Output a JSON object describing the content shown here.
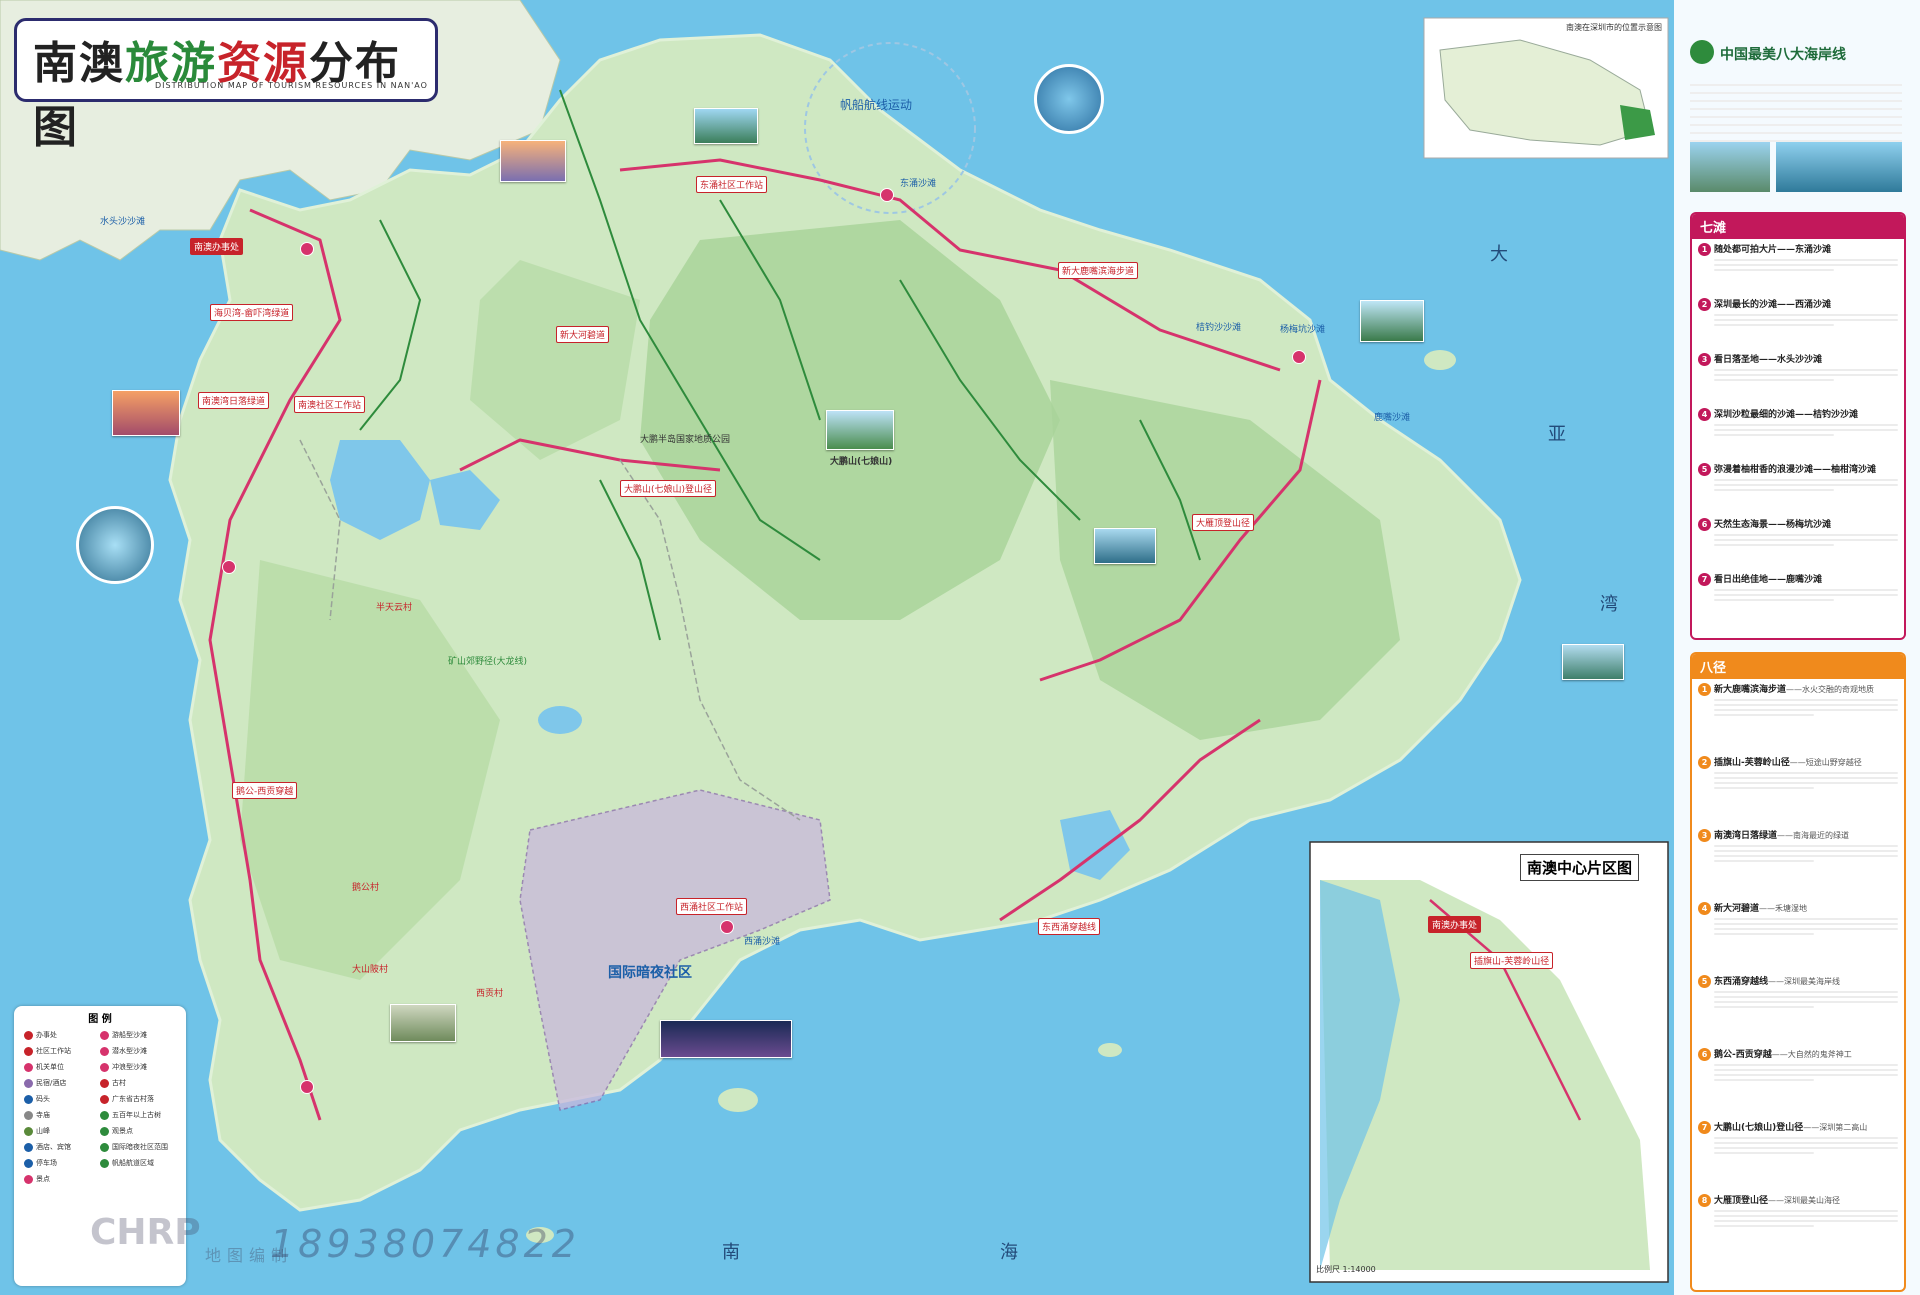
{
  "title": {
    "part1": "南澳",
    "part2": "旅游",
    "part3": "资源",
    "part4": "分布图",
    "subtitle": "DISTRIBUTION MAP OF TOURISM RESOURCES IN NAN'AO"
  },
  "colors": {
    "sea": "#6fc3e8",
    "land": "#cfe8c2",
    "forest": "#a9d39a",
    "route": "#d6336c",
    "trail": "#2e8b3c",
    "accent_pink": "#c2185b",
    "accent_orange": "#f08a1c"
  },
  "sea_labels": {
    "da": "大",
    "ya": "亚",
    "wan": "湾",
    "nan": "南",
    "hai": "海"
  },
  "locator": {
    "title": "南澳在深圳市的位置示意图"
  },
  "coast_panel": {
    "title": "中国最美八大海岸线"
  },
  "qitan": {
    "header": "七滩",
    "items": [
      {
        "num": "1",
        "title": "随处都可拍大片——东涌沙滩"
      },
      {
        "num": "2",
        "title": "深圳最长的沙滩——西涌沙滩"
      },
      {
        "num": "3",
        "title": "看日落圣地——水头沙沙滩"
      },
      {
        "num": "4",
        "title": "深圳沙粒最细的沙滩——桔钓沙沙滩"
      },
      {
        "num": "5",
        "title": "弥漫着柚柑香的浪漫沙滩——柚柑湾沙滩"
      },
      {
        "num": "6",
        "title": "天然生态海景——杨梅坑沙滩"
      },
      {
        "num": "7",
        "title": "看日出绝佳地——鹿嘴沙滩"
      }
    ]
  },
  "bajing": {
    "header": "八径",
    "items": [
      {
        "num": "1",
        "title": "新大鹿嘴滨海步道",
        "sub": "——水火交融的奇观地质"
      },
      {
        "num": "2",
        "title": "插旗山-芙蓉岭山径",
        "sub": "——短途山野穿越径"
      },
      {
        "num": "3",
        "title": "南澳湾日落绿道",
        "sub": "——南海最近的绿道"
      },
      {
        "num": "4",
        "title": "新大河碧道",
        "sub": "——禾塘湿地"
      },
      {
        "num": "5",
        "title": "东西涌穿越线",
        "sub": "——深圳最美海岸线"
      },
      {
        "num": "6",
        "title": "鹅公-西贡穿越",
        "sub": "——大自然的鬼斧神工"
      },
      {
        "num": "7",
        "title": "大鹏山(七娘山)登山径",
        "sub": "——深圳第二高山"
      },
      {
        "num": "8",
        "title": "大雁顶登山径",
        "sub": "——深圳最美山海径"
      }
    ]
  },
  "inset": {
    "title": "南澳中心片区图",
    "office": "南澳办事处",
    "trail": "插旗山-芙蓉岭山径",
    "scale": "比例尺 1:14000"
  },
  "legend": {
    "title": "图 例",
    "left": [
      "办事处",
      "社区工作站",
      "机关单位",
      "民宿/酒店",
      "码头",
      "寺庙",
      "山峰",
      "酒店、宾馆",
      "停车场",
      "景点"
    ],
    "right": [
      "游船型沙滩",
      "潜水型沙滩",
      "冲浪型沙滩",
      "古村",
      "广东省古村落",
      "五百年以上古树",
      "观景点",
      "国际暗夜社区范围",
      "帆船航道区域"
    ]
  },
  "map_labels": {
    "office": "南澳办事处",
    "haibei": "海贝湾-畲吓湾绿道",
    "nanao_sunset": "南澳湾日落绿道",
    "xinda_river": "新大河碧道",
    "dapeng_shan": "大鹏山(七娘山)登山径",
    "dayan_ding": "大雁顶登山径",
    "egong": "鹅公-西贡穿越",
    "east_west": "东西涌穿越线",
    "xinda_luzui": "新大鹿嘴滨海步道",
    "sailing": "帆船航线运动",
    "dark_sky": "国际暗夜社区",
    "kuangshan": "矿山郊野径(大龙线)",
    "dongchong_work": "东涌社区工作站",
    "xichong_work": "西涌社区工作站",
    "shuitousha": "水头沙沙滩",
    "xichong_beach": "西涌沙滩",
    "dongchong_beach": "东涌沙滩",
    "yanggang": "杨梅坑沙滩",
    "luzui": "鹿嘴沙滩",
    "jiediaosha": "桔钓沙沙滩",
    "geopark": "大鹏半岛国家地质公园",
    "qiniang": "大鹏山(七娘山)",
    "egong_village": "鹅公村",
    "banshan": "半天云村",
    "dashan_village": "大山陂村",
    "xigong": "西贡村",
    "dongchong_village": "东涌社区工作站",
    "nanao_community": "南澳社区工作站"
  },
  "watermark": {
    "logo": "CHRP",
    "phone": "18938074822",
    "sub": "地图编制"
  }
}
